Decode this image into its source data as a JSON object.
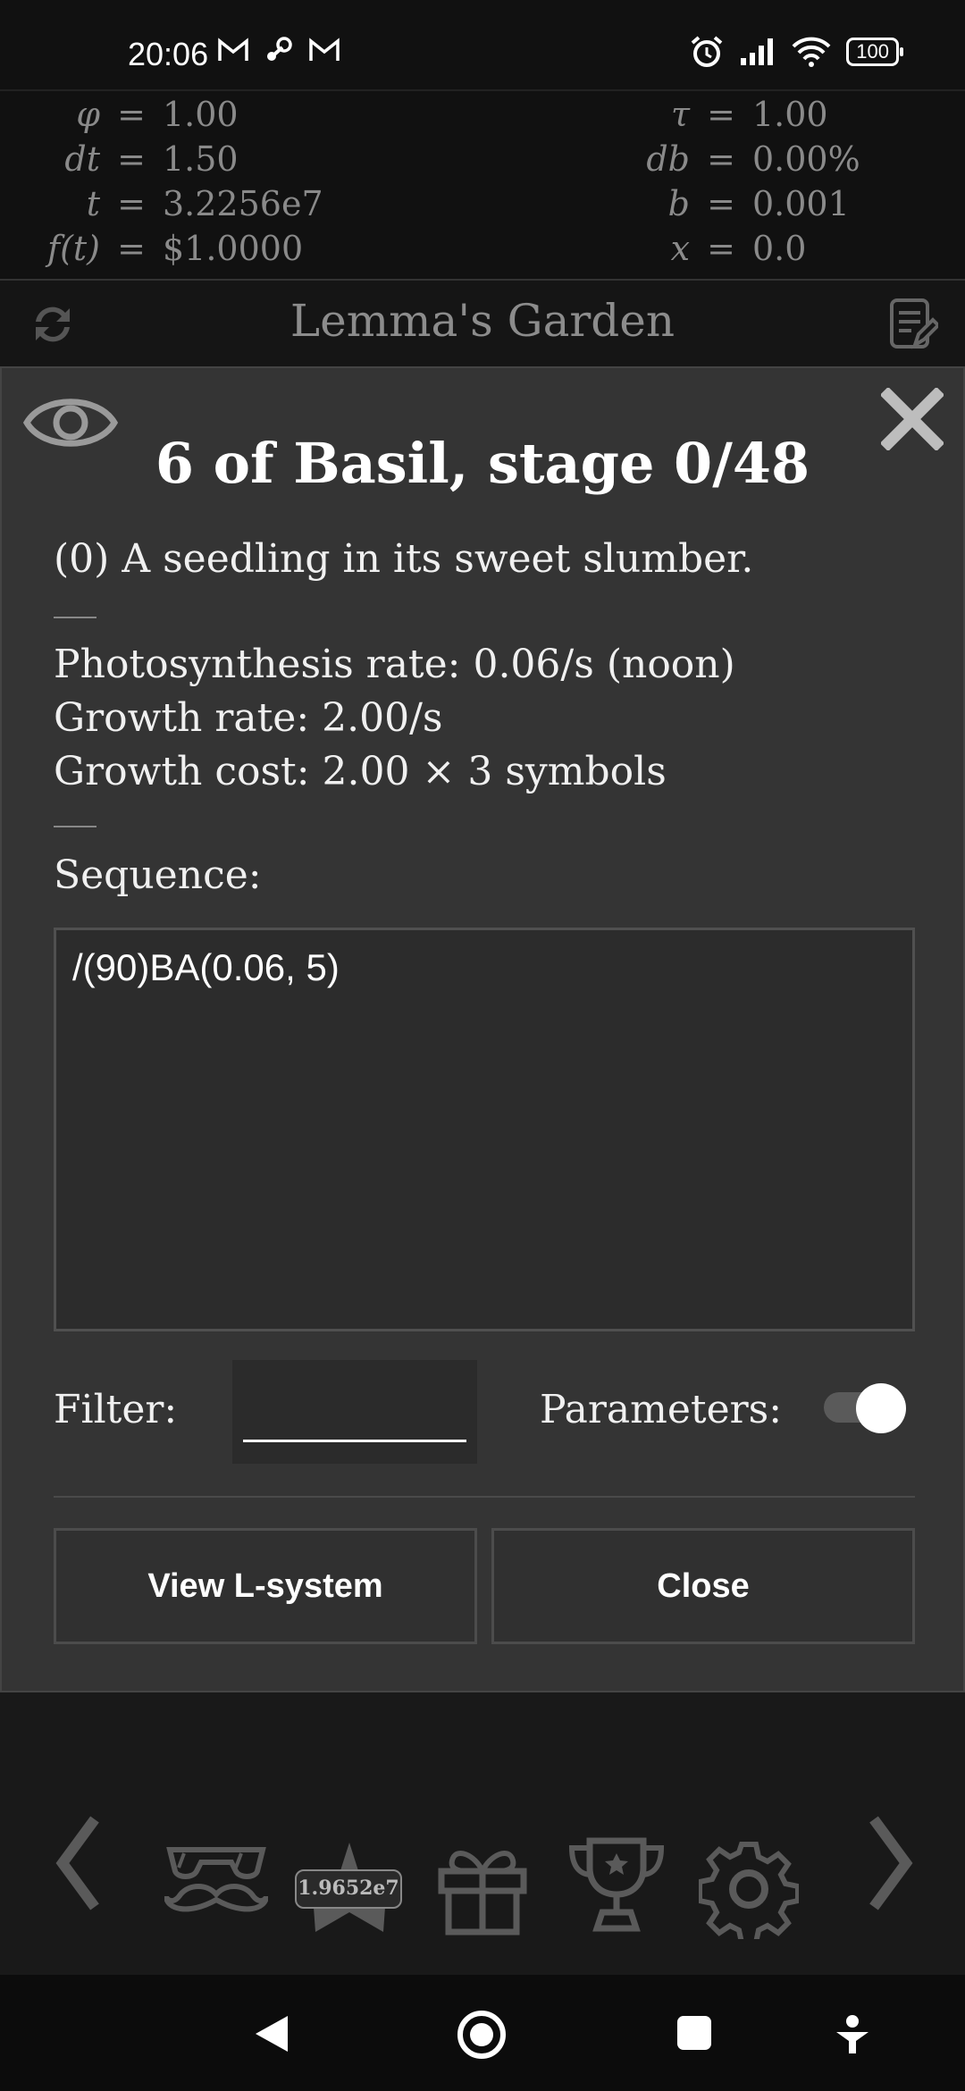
{
  "status_bar": {
    "time": "20:06",
    "battery": "100"
  },
  "variables": {
    "left": [
      {
        "symbol": "φ",
        "value": "1.00"
      },
      {
        "symbol": "dt",
        "value": "1.50"
      },
      {
        "symbol": "t",
        "value": "3.2256e7"
      },
      {
        "symbol": "f(t)",
        "value": "$1.0000"
      }
    ],
    "right": [
      {
        "symbol": "τ",
        "value": "1.00"
      },
      {
        "symbol": "db",
        "value": "0.00%"
      },
      {
        "symbol": "b",
        "value": "0.001"
      },
      {
        "symbol": "x",
        "value": "0.0"
      }
    ],
    "equals": "="
  },
  "header": {
    "title": "Lemma's Garden"
  },
  "modal": {
    "title": "6 of Basil, stage 0/48",
    "description": "(0) A seedling in its sweet slumber.",
    "stats": [
      "Photosynthesis rate: 0.06/s (noon)",
      "Growth rate: 2.00/s",
      "Growth cost: 2.00 × 3 symbols"
    ],
    "sequence_label": "Sequence:",
    "sequence_value": "/(90)BA(0.06, 5)",
    "filter_label": "Filter:",
    "filter_value": "",
    "parameters_label": "Parameters:",
    "parameters_on": true,
    "view_button": "View L-system",
    "close_button": "Close"
  },
  "bottom_nav": {
    "badge": "1.9652e7"
  }
}
